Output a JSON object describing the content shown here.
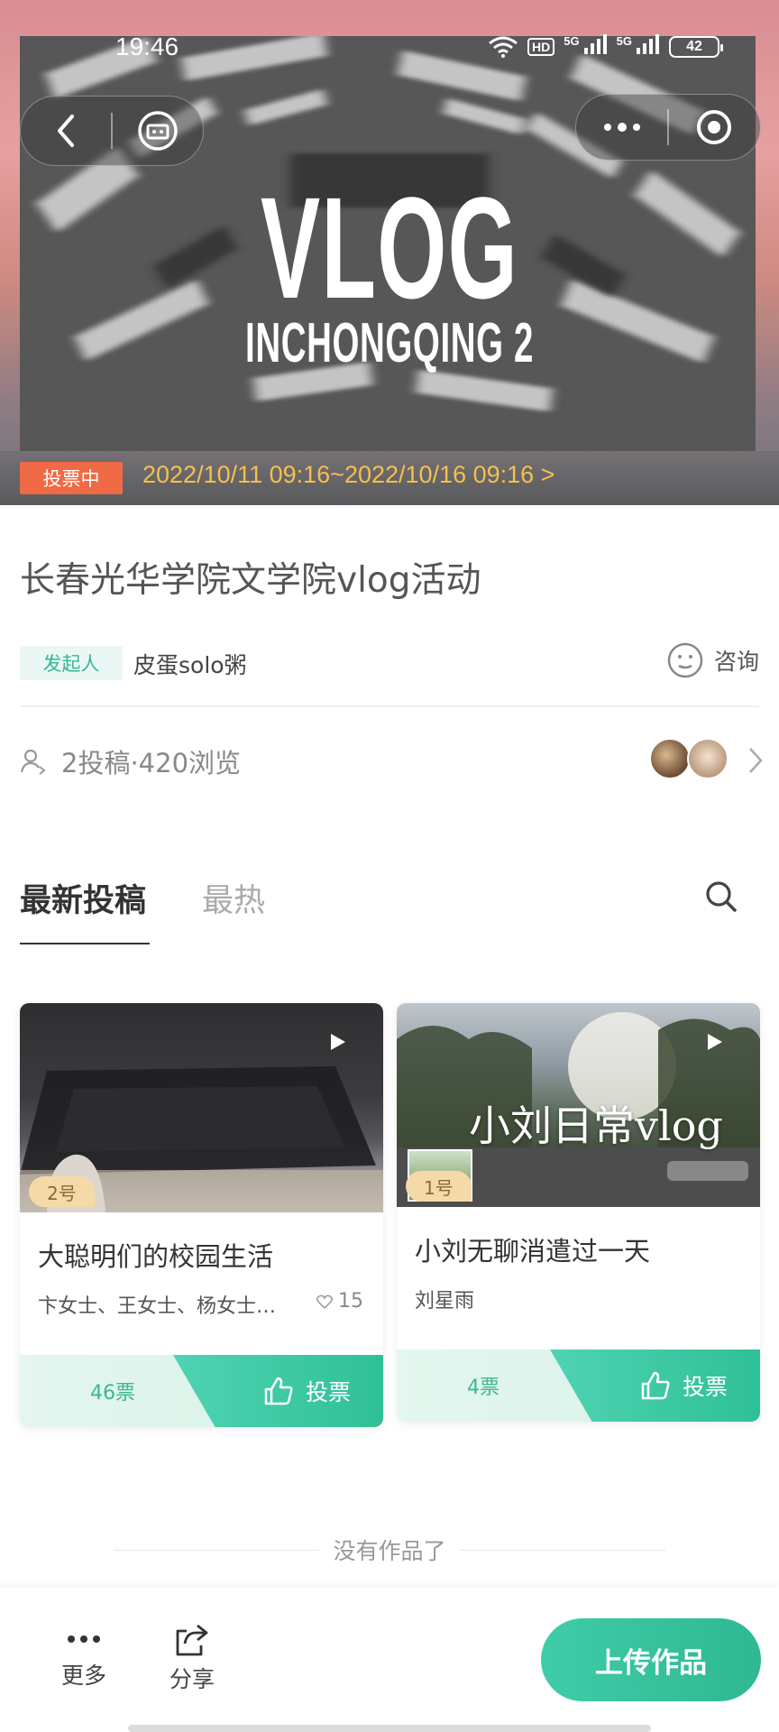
{
  "status_bar": {
    "time": "19:46",
    "hd": "HD",
    "net1": "5G",
    "net2": "5G",
    "battery": "42"
  },
  "hero": {
    "title_big": "VLOG",
    "title_sub": "INCHONGQING 2",
    "status_badge": "投票中",
    "date_range": "2022/10/11 09:16~2022/10/16 09:16 >"
  },
  "activity": {
    "title": "长春光华学院文学院vlog活动",
    "initiator_tag": "发起人",
    "initiator_name": "皮蛋solo粥",
    "consult_label": "咨询",
    "stats": "2投稿·420浏览"
  },
  "tabs": {
    "latest": "最新投稿",
    "hot": "最热"
  },
  "cards": [
    {
      "number": "2号",
      "title": "大聪明们的校园生活",
      "authors": "卞女士、王女士、杨女士…",
      "likes": "15",
      "votes": "46票",
      "vote_label": "投票"
    },
    {
      "number": "1号",
      "thumb_text": "小刘日常vlog",
      "title": "小刘无聊消遣过一天",
      "authors": "刘星雨",
      "votes": "4票",
      "vote_label": "投票"
    }
  ],
  "footer": {
    "no_more": "没有作品了",
    "more_label": "更多",
    "share_label": "分享",
    "upload_label": "上传作品"
  },
  "colors": {
    "accent": "#2fc096",
    "vote_badge": "#ef6a45",
    "date_text": "#f6c04a"
  }
}
